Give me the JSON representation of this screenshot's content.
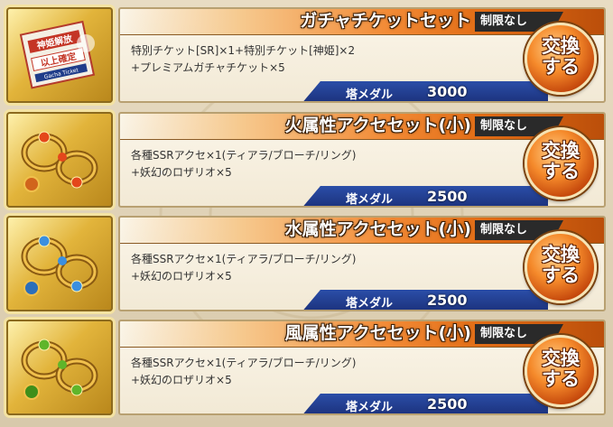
{
  "items": [
    {
      "title": "ガチャチケットセット",
      "limit": "制限なし",
      "desc_line1": "特別チケット[SR]×1+特別チケット[神姫]×2",
      "desc_line2": "+プレミアムガチャチケット×5",
      "price_label": "塔メダル",
      "price": "3000",
      "button_line1": "交換",
      "button_line2": "する",
      "icon": "gacha-ticket-icon",
      "ticket_text1": "神姫解放",
      "ticket_text2": "以上確定",
      "ticket_text3": "Gacha Ticket"
    },
    {
      "title": "火属性アクセセット(小)",
      "limit": "制限なし",
      "desc_line1": "各種SSRアクセ×1(ティアラ/ブローチ/リング)",
      "desc_line2": "+妖幻のロザリオ×5",
      "price_label": "塔メダル",
      "price": "2500",
      "button_line1": "交換",
      "button_line2": "する",
      "icon": "fire-accessory-icon",
      "gem_color": "#e4471b"
    },
    {
      "title": "水属性アクセセット(小)",
      "limit": "制限なし",
      "desc_line1": "各種SSRアクセ×1(ティアラ/ブローチ/リング)",
      "desc_line2": "+妖幻のロザリオ×5",
      "price_label": "塔メダル",
      "price": "2500",
      "button_line1": "交換",
      "button_line2": "する",
      "icon": "water-accessory-icon",
      "gem_color": "#3b8fe0"
    },
    {
      "title": "風属性アクセセット(小)",
      "limit": "制限なし",
      "desc_line1": "各種SSRアクセ×1(ティアラ/ブローチ/リング)",
      "desc_line2": "+妖幻のロザリオ×5",
      "price_label": "塔メダル",
      "price": "2500",
      "button_line1": "交換",
      "button_line2": "する",
      "icon": "wind-accessory-icon",
      "gem_color": "#5fb52a"
    }
  ]
}
